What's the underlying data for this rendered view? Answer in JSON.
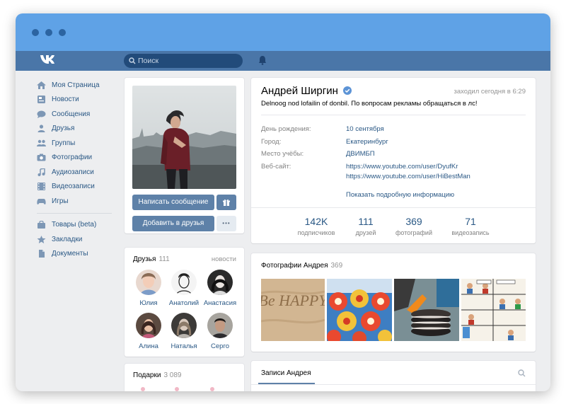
{
  "header": {
    "logo": "VK",
    "search_placeholder": "Поиск"
  },
  "nav": {
    "items": [
      {
        "label": "Моя Страница",
        "icon": "home-icon"
      },
      {
        "label": "Новости",
        "icon": "news-icon"
      },
      {
        "label": "Сообщения",
        "icon": "messages-icon"
      },
      {
        "label": "Друзья",
        "icon": "friends-icon"
      },
      {
        "label": "Группы",
        "icon": "groups-icon"
      },
      {
        "label": "Фотографии",
        "icon": "camera-icon"
      },
      {
        "label": "Аудиозаписи",
        "icon": "music-icon"
      },
      {
        "label": "Видеозаписи",
        "icon": "video-icon"
      },
      {
        "label": "Игры",
        "icon": "gamepad-icon"
      }
    ],
    "items2": [
      {
        "label": "Товары (beta)",
        "icon": "bag-icon"
      },
      {
        "label": "Закладки",
        "icon": "star-icon"
      },
      {
        "label": "Документы",
        "icon": "document-icon"
      }
    ]
  },
  "profile_actions": {
    "message_btn": "Написать сообщение",
    "add_friend_btn": "Добавить в друзья",
    "more": "•••"
  },
  "profile": {
    "name": "Андрей Ширгин",
    "last_seen": "заходил сегодня в 6:29",
    "status": "Delnoog nod lofailin of donbil. По вопросам рекламы обращаться в лс!",
    "info": [
      {
        "label": "День рождения:",
        "value": "10 сентября"
      },
      {
        "label": "Город:",
        "value": "Екатеринбург"
      },
      {
        "label": "Место учёбы:",
        "value": "ДВИМБП"
      },
      {
        "label": "Веб-сайт:",
        "value": "https://www.youtube.com/user/DyufKr"
      }
    ],
    "website2": "https://www.youtube.com/user/HiBestMan",
    "show_more": "Показать подробную информацию",
    "stats": [
      {
        "num": "142K",
        "label": "подписчиков"
      },
      {
        "num": "111",
        "label": "друзей"
      },
      {
        "num": "369",
        "label": "фотографий"
      },
      {
        "num": "71",
        "label": "видеозапись"
      }
    ]
  },
  "friends": {
    "title": "Друзья",
    "count": "111",
    "news_link": "новости",
    "list": [
      "Юлия",
      "Анатолий",
      "Анастасия",
      "Алина",
      "Наталья",
      "Серго"
    ]
  },
  "gifts": {
    "title": "Подарки",
    "count": "3 089"
  },
  "photos": {
    "title": "Фотографии Андрея",
    "count": "369",
    "thumb1_text": "Be HAPPY"
  },
  "wall": {
    "title": "Записи Андрея"
  },
  "colors": {
    "header": "#4a76a8",
    "titlebar": "#5fa2e6",
    "link": "#2a5885",
    "button": "#5e81a8"
  }
}
